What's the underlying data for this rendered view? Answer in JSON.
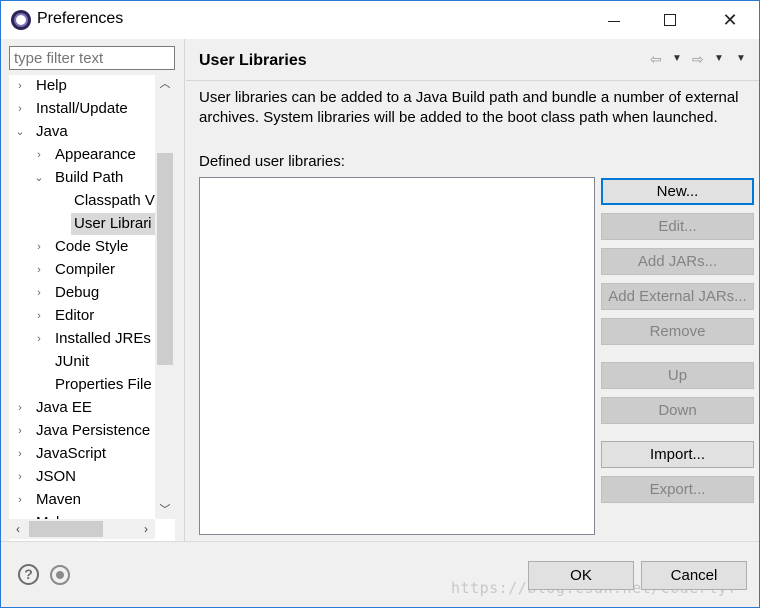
{
  "window": {
    "title": "Preferences"
  },
  "filter": {
    "placeholder": "type filter text"
  },
  "tree": {
    "items": [
      {
        "label": "Help",
        "depth": 0,
        "twisty": "›"
      },
      {
        "label": "Install/Update",
        "depth": 0,
        "twisty": "›"
      },
      {
        "label": "Java",
        "depth": 0,
        "twisty": "⌄"
      },
      {
        "label": "Appearance",
        "depth": 1,
        "twisty": "›"
      },
      {
        "label": "Build Path",
        "depth": 1,
        "twisty": "⌄"
      },
      {
        "label": "Classpath V",
        "depth": 2,
        "twisty": ""
      },
      {
        "label": "User Librari",
        "depth": 2,
        "twisty": "",
        "selected": true
      },
      {
        "label": "Code Style",
        "depth": 1,
        "twisty": "›"
      },
      {
        "label": "Compiler",
        "depth": 1,
        "twisty": "›"
      },
      {
        "label": "Debug",
        "depth": 1,
        "twisty": "›"
      },
      {
        "label": "Editor",
        "depth": 1,
        "twisty": "›"
      },
      {
        "label": "Installed JREs",
        "depth": 1,
        "twisty": "›"
      },
      {
        "label": "JUnit",
        "depth": 1,
        "twisty": ""
      },
      {
        "label": "Properties File",
        "depth": 1,
        "twisty": ""
      },
      {
        "label": "Java EE",
        "depth": 0,
        "twisty": "›"
      },
      {
        "label": "Java Persistence",
        "depth": 0,
        "twisty": "›"
      },
      {
        "label": "JavaScript",
        "depth": 0,
        "twisty": "›"
      },
      {
        "label": "JSON",
        "depth": 0,
        "twisty": "›"
      },
      {
        "label": "Maven",
        "depth": 0,
        "twisty": "›"
      },
      {
        "label": "Mylyn",
        "depth": 0,
        "twisty": "›"
      }
    ]
  },
  "page": {
    "title": "User Libraries",
    "description": "User libraries can be added to a Java Build path and bundle a number of external archives. System libraries will be added to the boot class path when launched.",
    "defined_label": "Defined user libraries:"
  },
  "buttons": {
    "new": "New...",
    "edit": "Edit...",
    "add_jars": "Add JARs...",
    "add_external_jars": "Add External JARs...",
    "remove": "Remove",
    "up": "Up",
    "down": "Down",
    "import": "Import...",
    "export": "Export..."
  },
  "footer": {
    "ok": "OK",
    "cancel": "Cancel",
    "watermark": "https://blog.csdn.net/coderlyf"
  },
  "colors": {
    "accent": "#0078d7",
    "selection": "#d9d9d9",
    "disabled_text": "#838383"
  }
}
